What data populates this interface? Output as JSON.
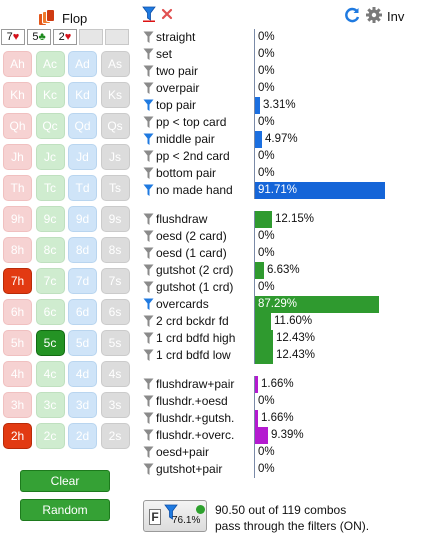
{
  "header": {
    "flop_label": "Flop",
    "inv_label": "Inv"
  },
  "board": [
    {
      "rank": "7",
      "suit": "♥",
      "suit_class": "suit-h"
    },
    {
      "rank": "5",
      "suit": "♣",
      "suit_class": "suit-c"
    },
    {
      "rank": "2",
      "suit": "♥",
      "suit_class": "suit-h"
    },
    {
      "rank": "",
      "suit": "",
      "suit_class": ""
    },
    {
      "rank": "",
      "suit": "",
      "suit_class": ""
    }
  ],
  "grid": [
    [
      "Ah",
      "Ac",
      "Ad",
      "As"
    ],
    [
      "Kh",
      "Kc",
      "Kd",
      "Ks"
    ],
    [
      "Qh",
      "Qc",
      "Qd",
      "Qs"
    ],
    [
      "Jh",
      "Jc",
      "Jd",
      "Js"
    ],
    [
      "Th",
      "Tc",
      "Td",
      "Ts"
    ],
    [
      "9h",
      "9c",
      "9d",
      "9s"
    ],
    [
      "8h",
      "8c",
      "8d",
      "8s"
    ],
    [
      "7h",
      "7c",
      "7d",
      "7s"
    ],
    [
      "6h",
      "6c",
      "6d",
      "6s"
    ],
    [
      "5h",
      "5c",
      "5d",
      "5s"
    ],
    [
      "4h",
      "4c",
      "4d",
      "4s"
    ],
    [
      "3h",
      "3c",
      "3d",
      "3s"
    ],
    [
      "2h",
      "2c",
      "2d",
      "2s"
    ]
  ],
  "selected_cards": [
    "7h",
    "5c",
    "2h"
  ],
  "buttons": {
    "clear": "Clear",
    "random": "Random"
  },
  "colors": {
    "blue_bar": "#1b6fe0",
    "navy_bar": "#1565d8",
    "green_bar": "#2f9a2f",
    "purple_bar": "#b41ad0",
    "filter_on": "#1f7ae0",
    "filter_off": "#8a8a8a"
  },
  "filters": [
    {
      "label": "straight",
      "pct": "0%",
      "value": 0,
      "active": false,
      "color": "",
      "group": 0
    },
    {
      "label": "set",
      "pct": "0%",
      "value": 0,
      "active": false,
      "color": "",
      "group": 0
    },
    {
      "label": "two pair",
      "pct": "0%",
      "value": 0,
      "active": false,
      "color": "",
      "group": 0
    },
    {
      "label": "overpair",
      "pct": "0%",
      "value": 0,
      "active": false,
      "color": "",
      "group": 0
    },
    {
      "label": "top pair",
      "pct": "3.31%",
      "value": 3.31,
      "active": true,
      "color": "#1b6fe0",
      "group": 0
    },
    {
      "label": "pp < top card",
      "pct": "0%",
      "value": 0,
      "active": false,
      "color": "",
      "group": 0
    },
    {
      "label": "middle pair",
      "pct": "4.97%",
      "value": 4.97,
      "active": true,
      "color": "#1b6fe0",
      "group": 0
    },
    {
      "label": "pp < 2nd card",
      "pct": "0%",
      "value": 0,
      "active": false,
      "color": "",
      "group": 0
    },
    {
      "label": "bottom pair",
      "pct": "0%",
      "value": 0,
      "active": false,
      "color": "",
      "group": 0
    },
    {
      "label": "no made hand",
      "pct": "91.71%",
      "value": 91.71,
      "active": true,
      "color": "#1565d8",
      "group": 0
    },
    {
      "label": "flushdraw",
      "pct": "12.15%",
      "value": 12.15,
      "active": false,
      "color": "#2f9a2f",
      "group": 1
    },
    {
      "label": "oesd (2 card)",
      "pct": "0%",
      "value": 0,
      "active": false,
      "color": "",
      "group": 1
    },
    {
      "label": "oesd (1 card)",
      "pct": "0%",
      "value": 0,
      "active": false,
      "color": "",
      "group": 1
    },
    {
      "label": "gutshot (2 crd)",
      "pct": "6.63%",
      "value": 6.63,
      "active": false,
      "color": "#2f9a2f",
      "group": 1
    },
    {
      "label": "gutshot (1 crd)",
      "pct": "0%",
      "value": 0,
      "active": false,
      "color": "",
      "group": 1
    },
    {
      "label": "overcards",
      "pct": "87.29%",
      "value": 87.29,
      "active": true,
      "color": "#2f9a2f",
      "group": 1
    },
    {
      "label": "2 crd bckdr fd",
      "pct": "11.60%",
      "value": 11.6,
      "active": false,
      "color": "#2f9a2f",
      "group": 1
    },
    {
      "label": "1 crd bdfd high",
      "pct": "12.43%",
      "value": 12.43,
      "active": false,
      "color": "#2f9a2f",
      "group": 1
    },
    {
      "label": "1 crd bdfd low",
      "pct": "12.43%",
      "value": 12.43,
      "active": false,
      "color": "#2f9a2f",
      "group": 1
    },
    {
      "label": "flushdraw+pair",
      "pct": "1.66%",
      "value": 1.66,
      "active": false,
      "color": "#b41ad0",
      "group": 2
    },
    {
      "label": "flushdr.+oesd",
      "pct": "0%",
      "value": 0,
      "active": false,
      "color": "",
      "group": 2
    },
    {
      "label": "flushdr.+gutsh.",
      "pct": "1.66%",
      "value": 1.66,
      "active": false,
      "color": "#b41ad0",
      "group": 2
    },
    {
      "label": "flushdr.+overc.",
      "pct": "9.39%",
      "value": 9.39,
      "active": false,
      "color": "#b41ad0",
      "group": 2
    },
    {
      "label": "oesd+pair",
      "pct": "0%",
      "value": 0,
      "active": false,
      "color": "",
      "group": 2
    },
    {
      "label": "gutshot+pair",
      "pct": "0%",
      "value": 0,
      "active": false,
      "color": "",
      "group": 2
    }
  ],
  "summary": {
    "filter_pct": "76.1%",
    "line1": "90.50 out of 119 combos",
    "line2": "pass through the filters (ON)."
  }
}
